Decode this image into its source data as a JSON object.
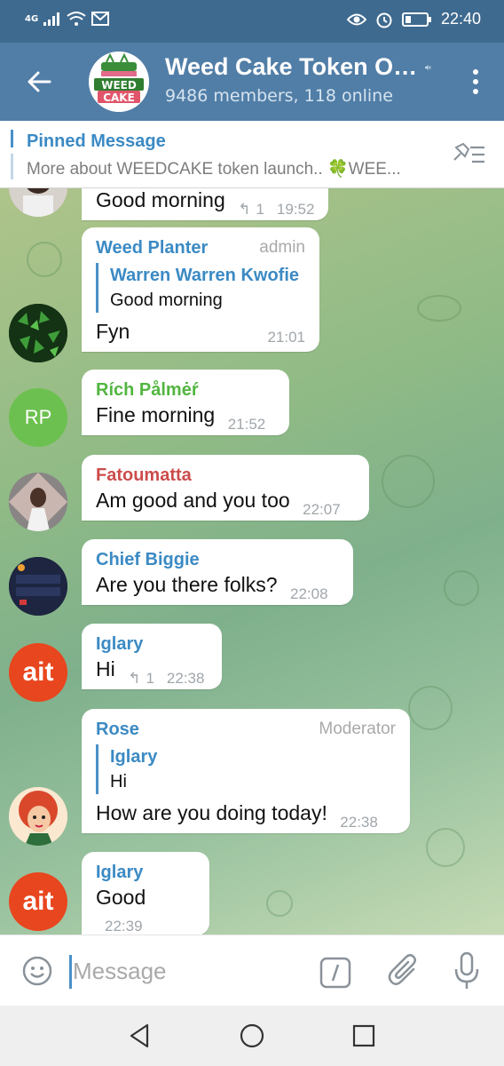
{
  "status_bar": {
    "network": "4G",
    "time": "22:40"
  },
  "header": {
    "title": "Weed Cake Token O…",
    "subtitle": "9486 members, 118 online",
    "logo_text_top": "WEED",
    "logo_text_bottom": "CAKE"
  },
  "pinned": {
    "label": "Pinned Message",
    "text": "More about WEEDCAKE token launch.. 🍀WEE..."
  },
  "messages": [
    {
      "sender": "",
      "text": "Good morning",
      "replies": "1",
      "time": "19:52"
    },
    {
      "sender": "Weed Planter",
      "badge": "admin",
      "reply_to_name": "Warren Warren Kwofie",
      "reply_to_text": "Good morning",
      "text": "Fyn",
      "time": "21:01"
    },
    {
      "sender": "Rích Pålmėŕ",
      "avatar_initials": "RP",
      "text": "Fine morning",
      "time": "21:52"
    },
    {
      "sender": "Fatoumatta",
      "text": "Am good and you too",
      "time": "22:07"
    },
    {
      "sender": "Chief Biggie",
      "text": "Are you there folks?",
      "time": "22:08"
    },
    {
      "sender": "Iglary",
      "avatar_text": "ait",
      "text": "Hi",
      "replies": "1",
      "time": "22:38"
    },
    {
      "sender": "Rose",
      "badge": "Moderator",
      "reply_to_name": "Iglary",
      "reply_to_text": "Hi",
      "text": "How are you doing today!",
      "time": "22:38"
    },
    {
      "sender": "Iglary",
      "avatar_text": "ait",
      "text": "Good",
      "time": "22:39"
    }
  ],
  "input": {
    "placeholder": "Message"
  },
  "colors": {
    "header": "#517ea7",
    "status_bar": "#3f6a8f",
    "sender_blue": "#3b8ac4",
    "sender_green": "#52b640",
    "sender_red": "#cc4c4c",
    "rp_avatar": "#6cc04f"
  }
}
